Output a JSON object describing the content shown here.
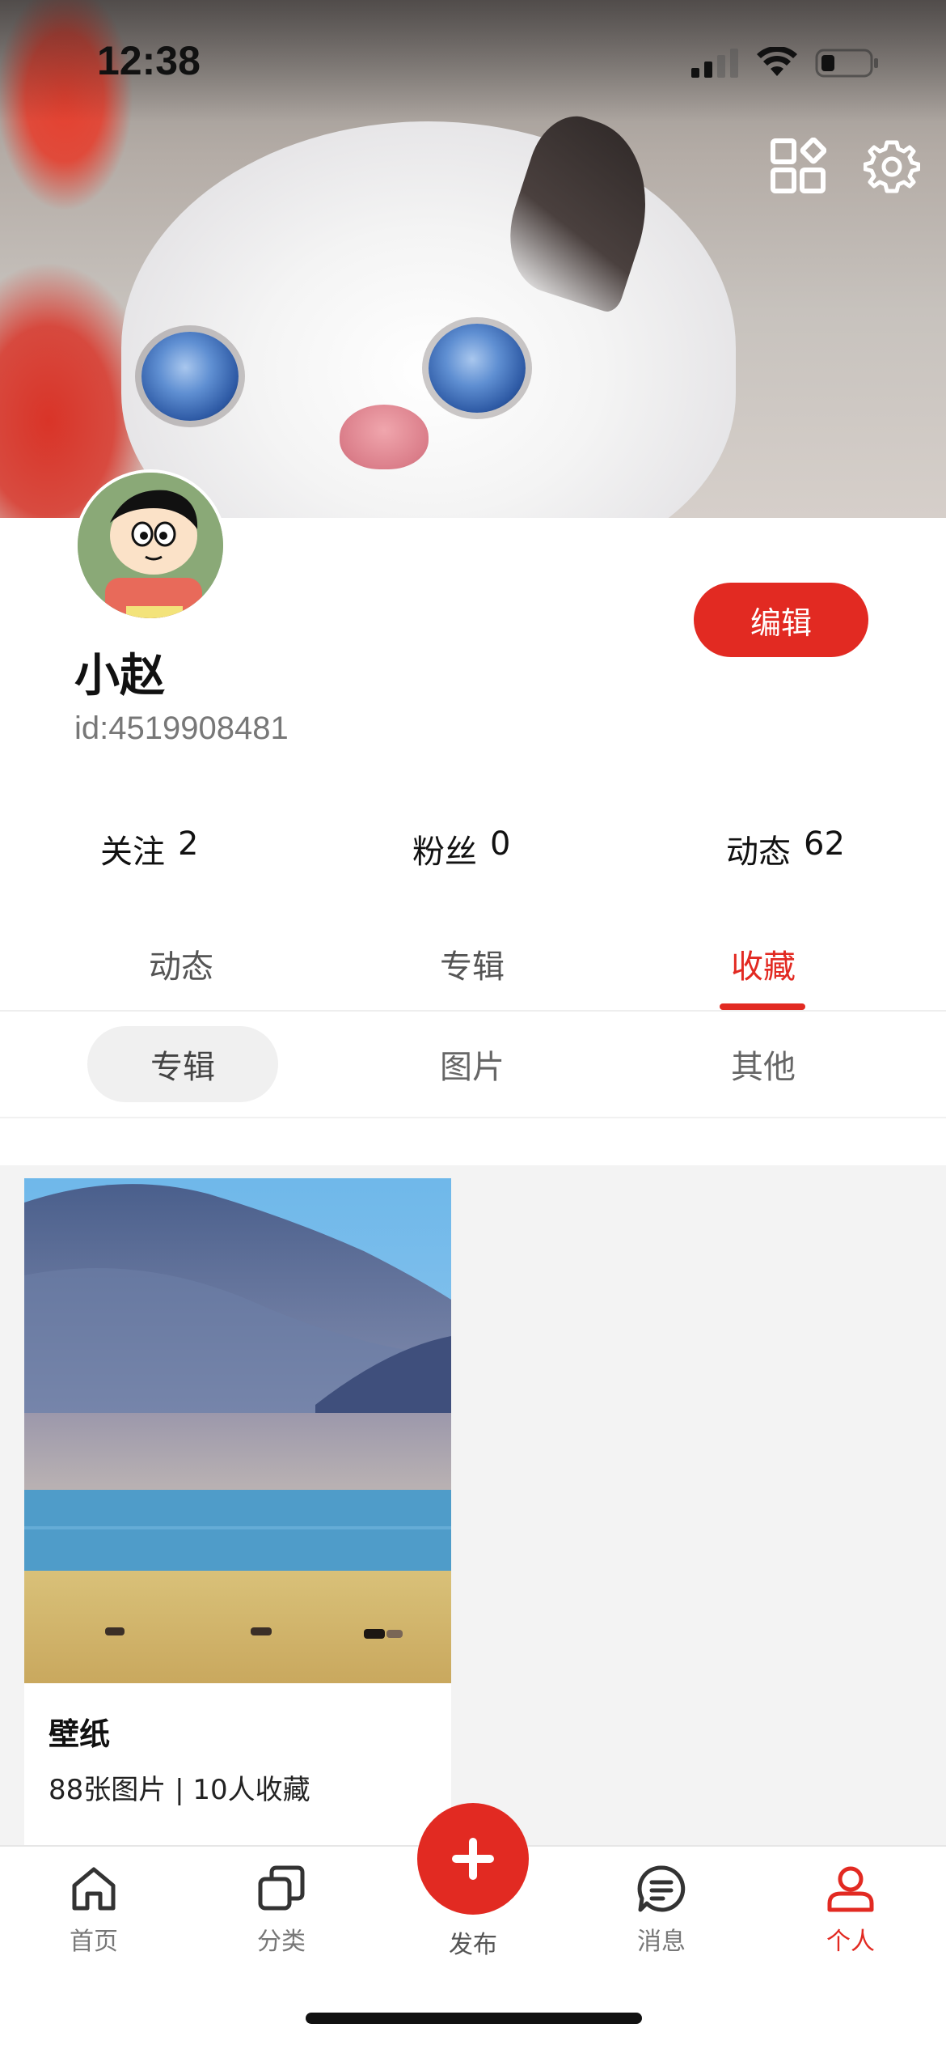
{
  "status_bar": {
    "time": "12:38"
  },
  "profile": {
    "edit_label": "编辑",
    "name": "小赵",
    "id_text": "id:4519908481"
  },
  "stats": [
    {
      "label": "关注",
      "value": "2"
    },
    {
      "label": "粉丝",
      "value": "0"
    },
    {
      "label": "动态",
      "value": "62"
    }
  ],
  "tabs": [
    {
      "label": "动态"
    },
    {
      "label": "专辑"
    },
    {
      "label": "收藏",
      "active": true
    }
  ],
  "subtabs": [
    {
      "label": "专辑",
      "active": true
    },
    {
      "label": "图片"
    },
    {
      "label": "其他"
    }
  ],
  "collection": [
    {
      "title": "壁纸",
      "meta": "88张图片 | 10人收藏"
    }
  ],
  "tabbar": {
    "items": [
      {
        "label": "首页",
        "icon": "home-icon"
      },
      {
        "label": "分类",
        "icon": "category-icon"
      },
      {
        "label": "发布",
        "icon": "plus-icon"
      },
      {
        "label": "消息",
        "icon": "message-icon"
      },
      {
        "label": "个人",
        "icon": "person-icon",
        "active": true
      }
    ]
  },
  "colors": {
    "accent": "#e22a22",
    "background": "#ffffff",
    "content_bg": "#f3f3f3"
  }
}
